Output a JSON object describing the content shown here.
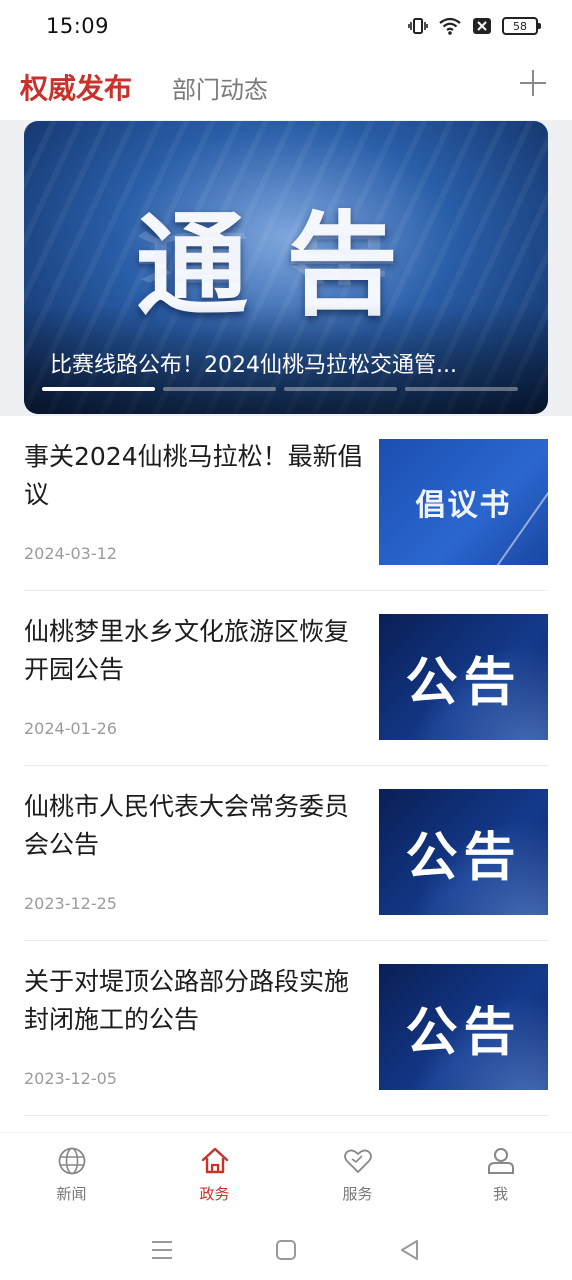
{
  "status_bar": {
    "time": "15:09",
    "battery": "58",
    "icons": [
      "vibrate-icon",
      "wifi-icon",
      "notification-x-icon",
      "battery-icon"
    ]
  },
  "top_tabs": {
    "active": "权威发布",
    "inactive": "部门动态",
    "add_icon": "plus-icon"
  },
  "banner": {
    "image_text": "通告",
    "caption": "比赛线路公布！2024仙桃马拉松交通管...",
    "slide_count": 4,
    "active_slide": 1
  },
  "news": [
    {
      "title": "事关2024仙桃马拉松！最新倡议",
      "date": "2024-03-12",
      "thumb_text": "倡议书",
      "thumb_style": "proposal"
    },
    {
      "title": "仙桃梦里水乡文化旅游区恢复开园公告",
      "date": "2024-01-26",
      "thumb_text": "公告",
      "thumb_style": "notice"
    },
    {
      "title": "仙桃市人民代表大会常务委员会公告",
      "date": "2023-12-25",
      "thumb_text": "公告",
      "thumb_style": "notice"
    },
    {
      "title": "关于对堤顶公路部分路段实施封闭施工的公告",
      "date": "2023-12-05",
      "thumb_text": "公告",
      "thumb_style": "notice"
    }
  ],
  "bottom_nav": [
    {
      "label": "新闻",
      "icon": "globe-icon",
      "active": false
    },
    {
      "label": "政务",
      "icon": "home-icon",
      "active": true
    },
    {
      "label": "服务",
      "icon": "heart-handshake-icon",
      "active": false
    },
    {
      "label": "我",
      "icon": "user-icon",
      "active": false
    }
  ],
  "colors": {
    "accent": "#c8322b",
    "inactive_text": "#777777",
    "date_text": "#9b9b9b"
  },
  "system_nav": [
    "menu-icon",
    "home-square-icon",
    "back-triangle-icon"
  ]
}
